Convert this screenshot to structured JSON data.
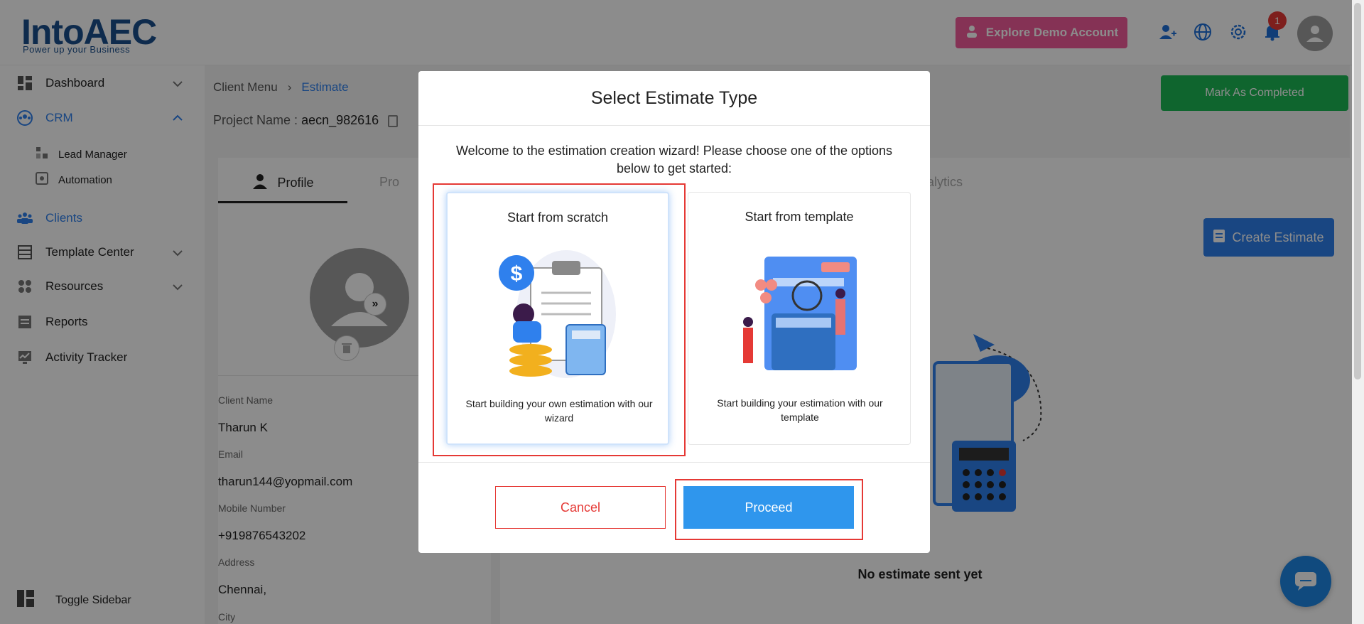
{
  "header": {
    "logo_text": "IntoAEC",
    "logo_tagline": "Power up your Business",
    "demo_button": "Explore Demo Account",
    "notification_count": "1"
  },
  "sidebar": {
    "items": [
      {
        "label": "Dashboard"
      },
      {
        "label": "CRM"
      },
      {
        "label": "Lead Manager"
      },
      {
        "label": "Automation"
      },
      {
        "label": "Clients"
      },
      {
        "label": "Template Center"
      },
      {
        "label": "Resources"
      },
      {
        "label": "Reports"
      },
      {
        "label": "Activity Tracker"
      }
    ],
    "toggle_label": "Toggle Sidebar"
  },
  "main": {
    "breadcrumb": {
      "parent": "Client Menu",
      "current": "Estimate"
    },
    "project_label": "Project Name :",
    "project_value": "aecn_982616",
    "mark_completed": "Mark As Completed",
    "tabs": {
      "profile": "Profile",
      "second": "Pro",
      "analytics": "alytics"
    },
    "create_estimate": "Create Estimate",
    "no_estimate": "No estimate sent yet",
    "fields": [
      {
        "label": "Client Name",
        "value": "Tharun K"
      },
      {
        "label": "Email",
        "value": "tharun144@yopmail.com"
      },
      {
        "label": "Mobile Number",
        "value": "+919876543202"
      },
      {
        "label": "Address",
        "value": "Chennai,"
      },
      {
        "label": "City",
        "value": ""
      }
    ]
  },
  "modal": {
    "title": "Select Estimate Type",
    "description": "Welcome to the estimation creation wizard! Please choose one of the options below to get started:",
    "options": [
      {
        "title": "Start from scratch",
        "description": "Start building your own estimation with our wizard",
        "selected": true
      },
      {
        "title": "Start from template",
        "description": "Start building your estimation with our template",
        "selected": false
      }
    ],
    "cancel": "Cancel",
    "proceed": "Proceed"
  },
  "colors": {
    "accent": "#2f80ed",
    "highlight": "#e53935",
    "success": "#1db954",
    "demo": "#f25b9b"
  }
}
